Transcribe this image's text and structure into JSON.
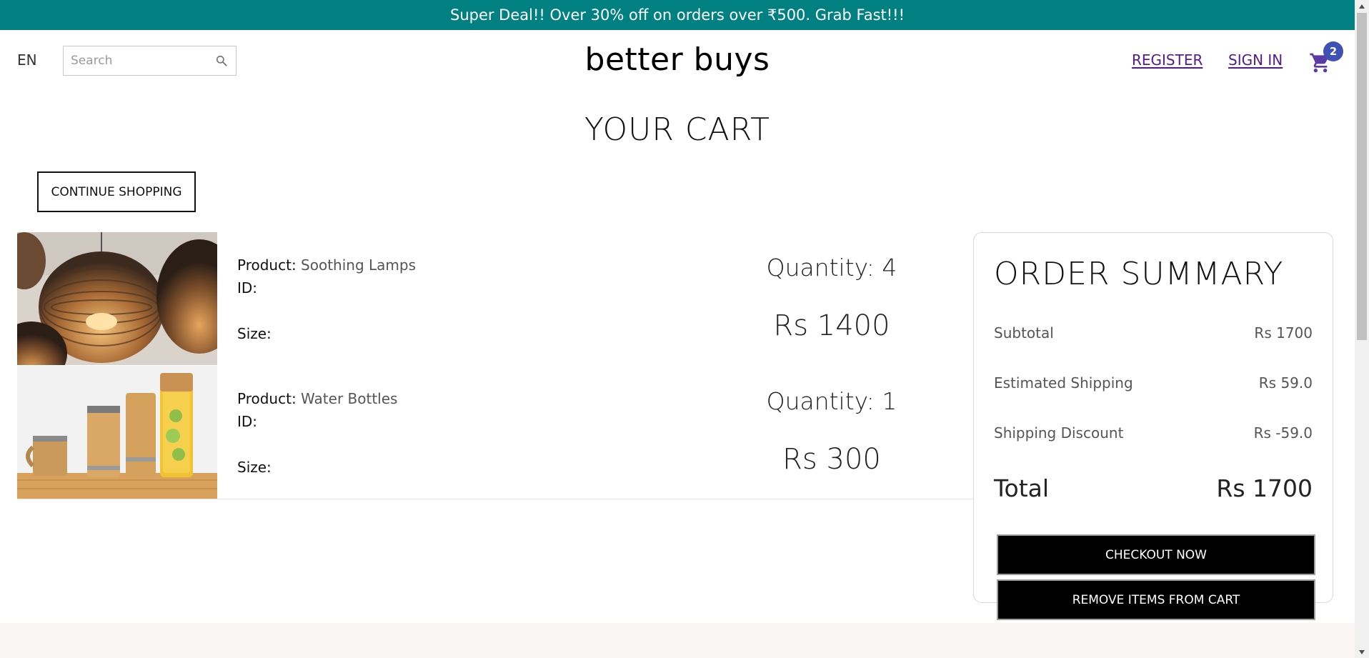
{
  "announcement": {
    "text": "Super Deal!! Over 30% off on orders over ₹500. Grab Fast!!!"
  },
  "header": {
    "language": "EN",
    "search_placeholder": "Search",
    "logo": "better buys",
    "register_label": "REGISTER",
    "signin_label": "SIGN IN",
    "cart_count": "2"
  },
  "cart": {
    "title": "YOUR CART",
    "continue_label": "CONTINUE SHOPPING",
    "product_label": "Product:",
    "id_label": "ID:",
    "size_label": "Size:",
    "items": [
      {
        "name": "Soothing Lamps",
        "id": "",
        "size": "",
        "quantity_text": "Quantity: 4",
        "price": "Rs 1400",
        "image_icon": "lamp-photo"
      },
      {
        "name": "Water Bottles",
        "id": "",
        "size": "",
        "quantity_text": "Quantity: 1",
        "price": "Rs 300",
        "image_icon": "bottles-photo"
      }
    ]
  },
  "summary": {
    "title": "ORDER SUMMARY",
    "subtotal_label": "Subtotal",
    "subtotal_value": "Rs 1700",
    "shipping_label": "Estimated Shipping",
    "shipping_value": "Rs 59.0",
    "discount_label": "Shipping Discount",
    "discount_value": "Rs -59.0",
    "total_label": "Total",
    "total_value": "Rs 1700",
    "checkout_label": "CHECKOUT NOW",
    "remove_label": "REMOVE ITEMS FROM CART"
  },
  "colors": {
    "announcement_bg": "#008080",
    "link": "#551a8b",
    "badge": "#3f51b5",
    "cart_icon": "#5b3aa6"
  }
}
